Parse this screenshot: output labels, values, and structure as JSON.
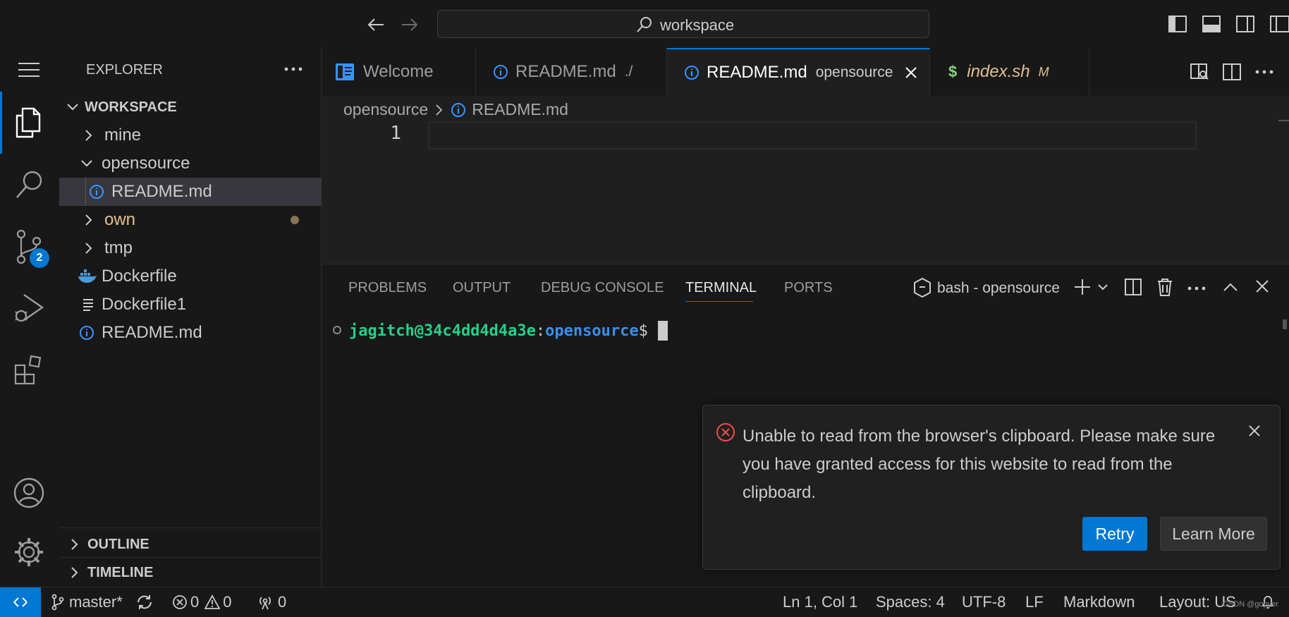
{
  "titlebar": {
    "search_text": "workspace"
  },
  "activity": {
    "scm_badge": "2"
  },
  "explorer": {
    "title": "EXPLORER",
    "workspace_label": "WORKSPACE",
    "items": [
      {
        "label": "mine",
        "type": "folder",
        "expanded": false
      },
      {
        "label": "opensource",
        "type": "folder",
        "expanded": true
      },
      {
        "label": "README.md",
        "type": "file-info",
        "selected": true
      },
      {
        "label": "own",
        "type": "folder",
        "expanded": false,
        "modified": true
      },
      {
        "label": "tmp",
        "type": "folder",
        "expanded": false
      },
      {
        "label": "Dockerfile",
        "type": "file-docker"
      },
      {
        "label": "Dockerfile1",
        "type": "file-text"
      },
      {
        "label": "README.md",
        "type": "file-info"
      }
    ],
    "outline_label": "OUTLINE",
    "timeline_label": "TIMELINE"
  },
  "tabs": [
    {
      "label": "Welcome",
      "sub": "",
      "icon": "welcome-icon"
    },
    {
      "label": "README.md",
      "sub": "./",
      "icon": "info-icon"
    },
    {
      "label": "README.md",
      "sub": "opensource",
      "icon": "info-icon",
      "active": true
    },
    {
      "label": "index.sh",
      "sub": "M",
      "icon": "dollar-icon"
    }
  ],
  "editor": {
    "breadcrumb": [
      "opensource",
      "README.md"
    ],
    "line_number": "1"
  },
  "panel": {
    "tabs": [
      "PROBLEMS",
      "OUTPUT",
      "DEBUG CONSOLE",
      "TERMINAL",
      "PORTS"
    ],
    "active_tab": "TERMINAL",
    "terminal_name": "bash - opensource",
    "prompt_user": "jagitch@34c4dd4d4a3e",
    "prompt_sep": ":",
    "prompt_path": "opensource",
    "prompt_symbol": "$"
  },
  "notification": {
    "message": "Unable to read from the browser's clipboard. Please make sure you have granted access for this website to read from the clipboard.",
    "retry_label": "Retry",
    "learn_more_label": "Learn More"
  },
  "statusbar": {
    "branch": "master*",
    "errors": "0",
    "warnings": "0",
    "ports": "0",
    "position": "Ln 1, Col 1",
    "spaces": "Spaces: 4",
    "encoding": "UTF-8",
    "eol": "LF",
    "language": "Markdown",
    "layout": "Layout: US",
    "watermark": "CSDN @gopyer"
  },
  "colors": {
    "accent": "#0078d4",
    "prompt_user": "#23d18b",
    "prompt_path": "#3b8eea",
    "modified": "#e2c08d",
    "error": "#f14c4c",
    "info": "#3794ff"
  }
}
